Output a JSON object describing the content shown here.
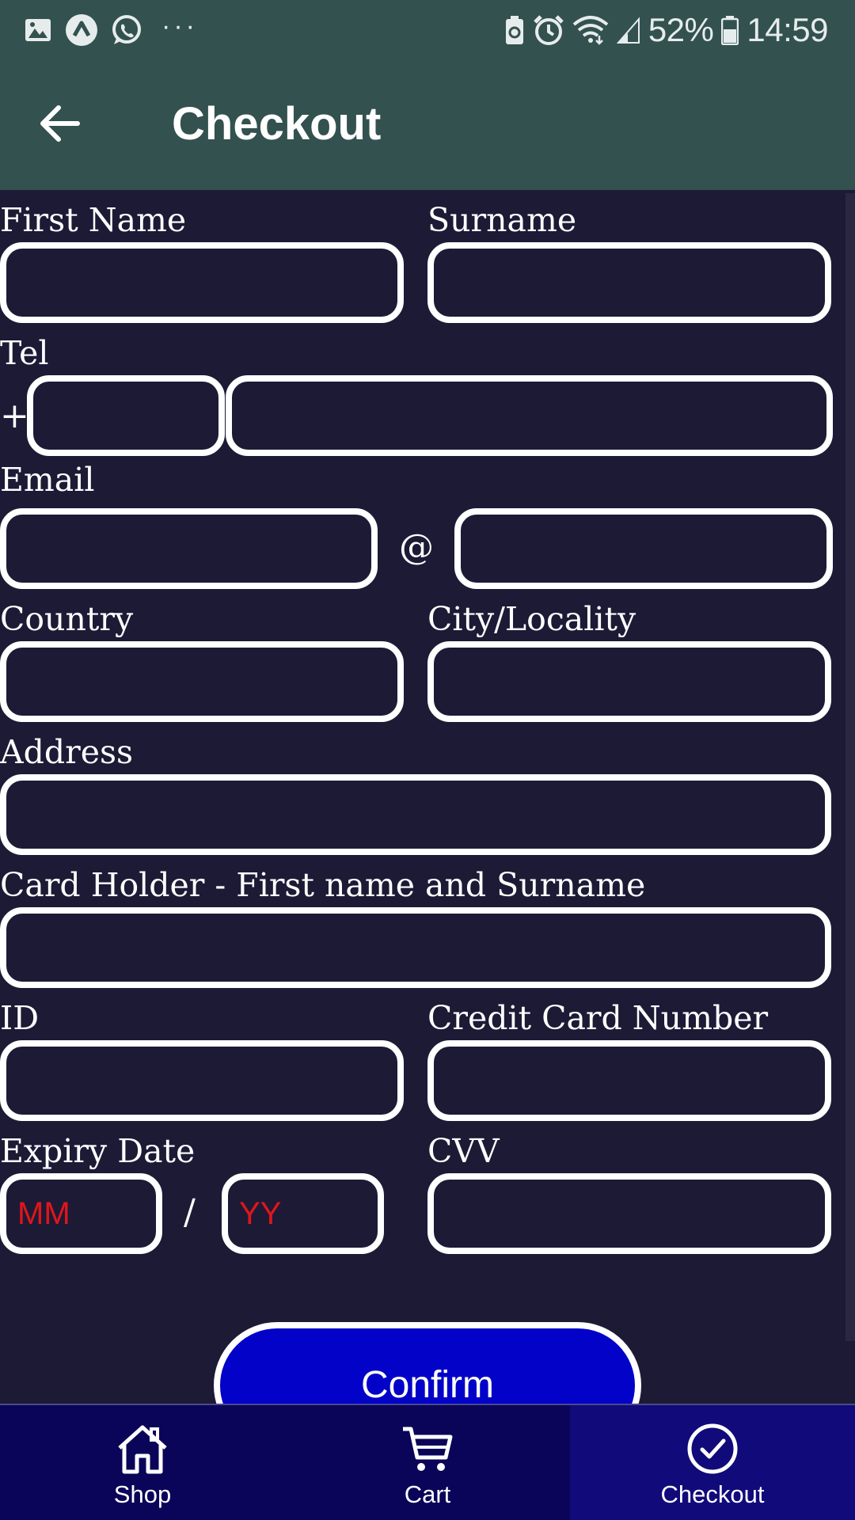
{
  "status_bar": {
    "battery": "52%",
    "time": "14:59",
    "left_icons": [
      "gallery-icon",
      "navigation-icon",
      "whatsapp-icon",
      "more-icon"
    ],
    "right_icons": [
      "battery-saver-icon",
      "alarm-icon",
      "wifi-icon",
      "signal-icon",
      "battery-icon"
    ],
    "dots": "···"
  },
  "app_bar": {
    "title": "Checkout",
    "back_icon": "arrow-left-icon",
    "color": "#33514f"
  },
  "form": {
    "first_name_label": "First Name",
    "surname_label": "Surname",
    "tel_label": "Tel",
    "tel_prefix": "+",
    "email_label": "Email",
    "email_at": "@",
    "country_label": "Country",
    "city_label": "City/Locality",
    "address_label": "Address",
    "card_holder_label": "Card Holder - First name and Surname",
    "id_label": "ID",
    "card_number_label": "Credit Card Number",
    "expiry_label": "Expiry Date",
    "expiry_sep": "/",
    "expiry_month_placeholder": "MM",
    "expiry_year_placeholder": "YY",
    "cvv_label": "CVV"
  },
  "confirm_button": {
    "label": "Confirm",
    "color": "#0202c8"
  },
  "bottom_nav": {
    "items": [
      {
        "label": "Shop",
        "icon": "home-icon",
        "active": false
      },
      {
        "label": "Cart",
        "icon": "cart-icon",
        "active": false
      },
      {
        "label": "Checkout",
        "icon": "check-circle-icon",
        "active": true
      }
    ],
    "background": "#0a0558"
  },
  "colors": {
    "page_background": "#1d1a36",
    "placeholder": "#e0161a"
  }
}
